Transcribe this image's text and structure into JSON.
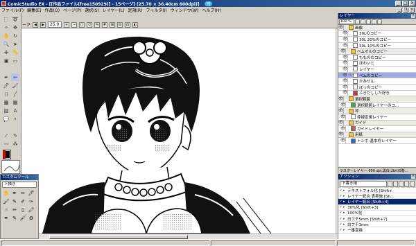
{
  "app": {
    "title": "ComicStudio EX - [[作品ファイル(free150929)] - 15ページ] (25.70 × 36.40cm 600dpi)]",
    "badge": "可"
  },
  "menu": [
    "ファイル(F)",
    "編集(E)",
    "作品(O)",
    "ページ(P)",
    "選択(S)",
    "レイヤー(L)",
    "定規(R)",
    "フィルタ(I)",
    "ウィンドウ(W)",
    "ヘルプ(H)"
  ],
  "doc": {
    "tab_label": "ーク",
    "zoom": "25.0"
  },
  "custom_tools": {
    "title": "カスタムツール",
    "selected": "下描き"
  },
  "layers": {
    "title": "レイヤー",
    "zoom": "100 %",
    "rows": [
      {
        "label": "画像",
        "kind": "folder"
      },
      {
        "label": "30Lのコピー",
        "kind": "layer"
      },
      {
        "label": "30L 20%のコピー",
        "kind": "layer"
      },
      {
        "label": "30L 10%のコピー",
        "kind": "layer"
      },
      {
        "label": "ベムオルのコピー",
        "kind": "folder"
      },
      {
        "label": "ももののコピー",
        "kind": "layer"
      },
      {
        "label": "ほわいと",
        "kind": "layer"
      },
      {
        "label": "レイヤー",
        "kind": "layer"
      },
      {
        "label": "べムのコピー",
        "kind": "selected"
      },
      {
        "label": "かみせん",
        "kind": "layer"
      },
      {
        "label": "ぼっのコピー",
        "kind": "layer"
      },
      {
        "label": "ふきだしした好き",
        "kind": "layer"
      },
      {
        "label": "選択範囲",
        "kind": "folder"
      },
      {
        "label": "選択範囲レイヤーのコ...",
        "kind": "layer"
      },
      {
        "label": "枠",
        "kind": "folder"
      },
      {
        "label": "枠線定規レイヤー",
        "kind": "layer"
      },
      {
        "label": "ガイド",
        "kind": "folder"
      },
      {
        "label": "ガイドレイヤー",
        "kind": "layer"
      },
      {
        "label": "用紙",
        "kind": "folder"
      },
      {
        "label": "トンボ-基本枠レイヤー",
        "kind": "layer"
      }
    ],
    "footer": "ラスターレイヤー 600 dpi,黒白(2bit)0階..."
  },
  "actions": {
    "title": "アクション",
    "set": "下書き用",
    "rows": [
      {
        "label": "テキストフォル化 [Shift+",
        "selected": false
      },
      {
        "label": "レイヤー統合 表実施 [Sh...",
        "selected": false
      },
      {
        "label": "レイヤー統合 [Shift+4]",
        "selected": true
      },
      {
        "label": "30%化 [Shift+3]",
        "selected": false
      },
      {
        "label": "100%化",
        "selected": false
      },
      {
        "label": "白フチ5mm [Shift+7]",
        "selected": false
      },
      {
        "label": "白フチ1mm",
        "selected": false
      },
      {
        "label": "一番変換",
        "selected": false
      }
    ]
  },
  "colors": {
    "titlebar": "#0a246a",
    "selected_layer": "#9da9e0",
    "folder": "#e8c260"
  }
}
